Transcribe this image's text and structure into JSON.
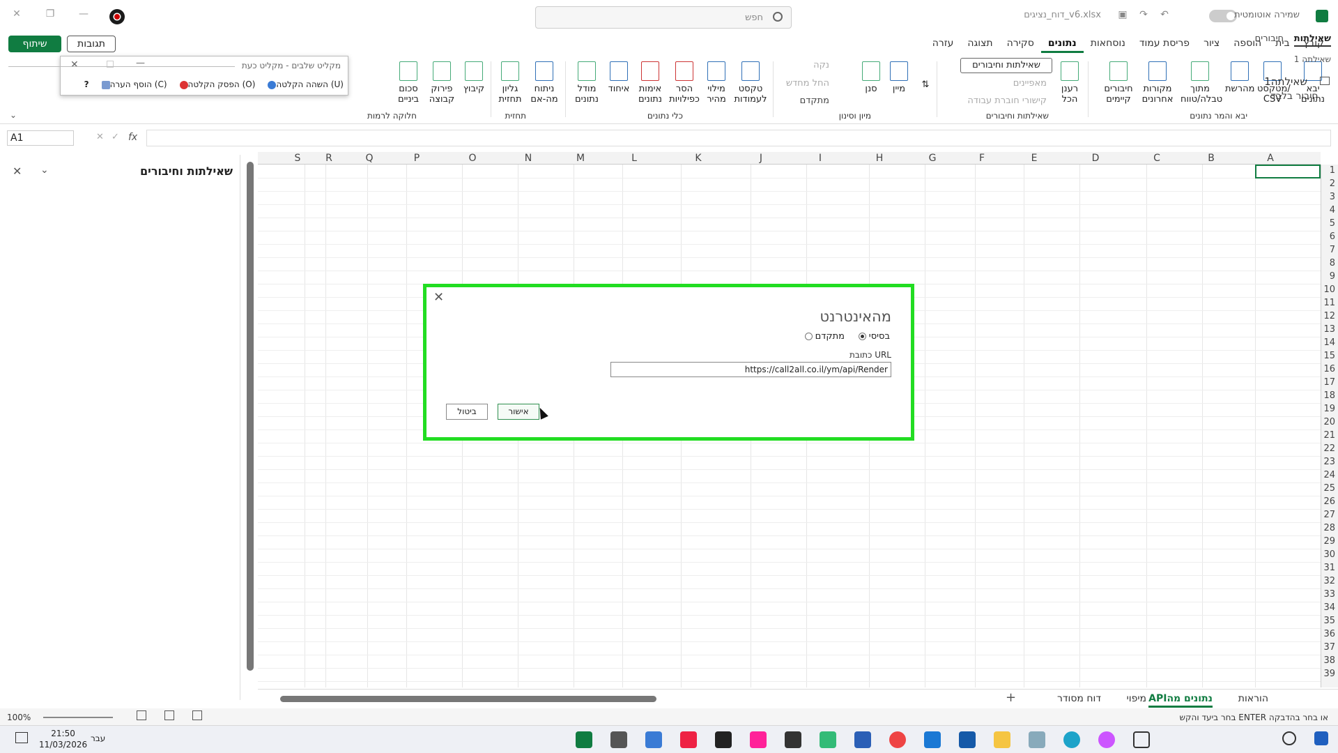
{
  "window": {
    "filename": "דוח_נציגים_v6.xlsx",
    "search_placeholder": "חפש",
    "autosave_label": "שמירה אוטומטית"
  },
  "header": {
    "share_label": "שיתוף",
    "comments_label": "תגובות"
  },
  "tabs": [
    "קובץ",
    "בית",
    "הוספה",
    "ציור",
    "פריסת עמוד",
    "נוסחאות",
    "נתונים",
    "סקירה",
    "תצוגה",
    "עזרה"
  ],
  "active_tab": "נתונים",
  "ribbon": {
    "get_data": "יבא נתונים",
    "from_text_csv": "מטקסט/ CSV",
    "from_web": "מהרשת",
    "from_table": "מתוך טבלה/טווח",
    "recent_sources": "מקורות אחרונים",
    "existing_connections": "חיבורים קיימים",
    "group_get_transform": "יבא והמר נתונים",
    "refresh_all": "רענן הכל",
    "queries_connections": "שאילתות וחיבורים",
    "properties": "מאפיינים",
    "workbook_links": "קישורי חוברת עבודה",
    "group_queries": "שאילתות וחיבורים",
    "sort": "מיין",
    "filter": "סנן",
    "clear": "נקה",
    "reapply": "החל מחדש",
    "advanced": "מתקדם",
    "group_sort_filter": "מיון וסינון",
    "text_to_columns": "טקסט לעמודות",
    "flash_fill": "מילוי מהיר",
    "remove_duplicates": "הסר כפילויות",
    "data_validation": "אימות נתונים",
    "consolidate": "איחוד",
    "data_model": "מודל נתונים",
    "group_data_tools": "כלי נתונים",
    "what_if": "ניתוח מה-אם",
    "forecast_sheet": "גליון תחזית",
    "group_forecast": "תחזית",
    "group": "קיבוץ",
    "ungroup": "פירוק קבוצה",
    "subtotal": "סכום ביניים",
    "group_outline": "חלוקה לרמות"
  },
  "steps_recorder": {
    "title": "מקליט שלבים - מקליט כעת",
    "pause": "השהה הקלטה (U)",
    "stop": "הפסק הקלטה (O)",
    "add_comment": "הוסף הערה (C)"
  },
  "formula_bar": {
    "name_box": "A1",
    "fx": "fx"
  },
  "queries_panel": {
    "title": "שאילתות וחיבורים",
    "tab_queries": "שאילתות",
    "tab_connections": "חיבורים",
    "count": "שאילתה 1",
    "item_name": "שאילתה1",
    "item_sub": "חיבור בלבד."
  },
  "columns": [
    "A",
    "B",
    "C",
    "D",
    "E",
    "F",
    "G",
    "H",
    "I",
    "J",
    "K",
    "L",
    "M",
    "N",
    "O",
    "P",
    "Q",
    "R",
    "S"
  ],
  "rows": [
    "1",
    "2",
    "3",
    "4",
    "5",
    "6",
    "7",
    "8",
    "9",
    "10",
    "11",
    "12",
    "13",
    "14",
    "15",
    "16",
    "17",
    "18",
    "19",
    "20",
    "21",
    "22",
    "23",
    "24",
    "25",
    "26",
    "27",
    "28",
    "29",
    "30",
    "31",
    "32",
    "33",
    "34",
    "35",
    "36",
    "37",
    "38",
    "39"
  ],
  "sheets": {
    "tabs": [
      "הוראות",
      "APIנתונים מה",
      "מיפוי",
      "דוח מסודר"
    ],
    "active": "APIנתונים מה",
    "add": "+"
  },
  "status": {
    "message": "בחר ביעד והקש ENTER או בחר בהדבקה",
    "zoom": "100%"
  },
  "taskbar": {
    "time": "21:50",
    "date": "11/03/2026",
    "lang": "עבר"
  },
  "dialog": {
    "title": "מהאינטרנט",
    "basic": "בסיסי",
    "advanced": "מתקדם",
    "url_label": "כתובת URL",
    "url_value": "https://call2all.co.il/ym/api/Render",
    "ok": "אישור",
    "cancel": "ביטול"
  },
  "colors": {
    "accent": "#107c41",
    "highlight": "#22dd22"
  }
}
